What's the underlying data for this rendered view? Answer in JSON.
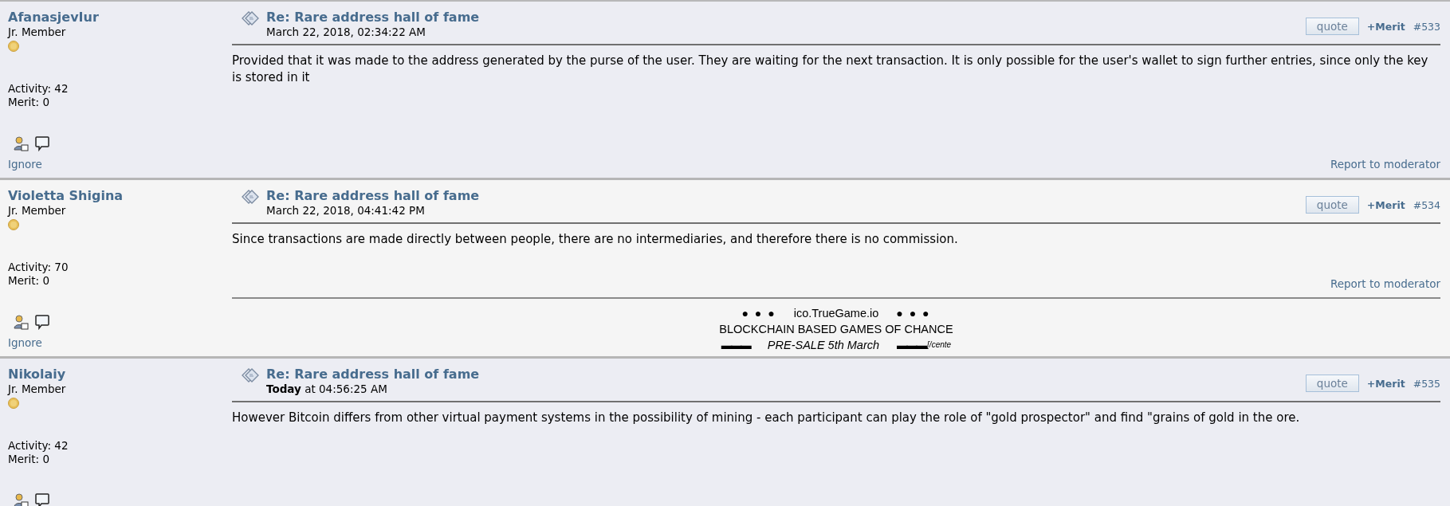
{
  "posts": [
    {
      "kind": "regular",
      "author": "AfanasjevIur",
      "rank": "Jr. Member",
      "activity": "Activity: 42",
      "merit": "Merit: 0",
      "ignore": "Ignore",
      "title": "Re: Rare address hall of fame",
      "date": "March 22, 2018, 02:34:22 AM",
      "quote": "quote",
      "merit_button": "+Merit",
      "number": "#533",
      "body": "Provided that it was made to the address generated by the purse of the user. They are waiting for the next transaction. It is only possible for the user's wallet to sign further entries, since only the key is stored in it",
      "report": "Report to moderator"
    },
    {
      "kind": "alternate",
      "author": "Violetta Shigina",
      "rank": "Jr. Member",
      "activity": "Activity: 70",
      "merit": "Merit: 0",
      "ignore": "Ignore",
      "title": "Re: Rare address hall of fame",
      "date": "March 22, 2018, 04:41:42 PM",
      "quote": "quote",
      "merit_button": "+Merit",
      "number": "#534",
      "body": "Since transactions are made directly between people, there are no intermediaries, and therefore there is no commission.",
      "report": "Report to moderator",
      "signature": {
        "dots_left": "● ● ●",
        "site": "ico.TrueGame.io",
        "dots_right": "● ● ●",
        "tagline": "BLOCKCHAIN BASED GAMES OF CHANCE",
        "bars_left": "▬▬▬",
        "presale": "PRE-SALE 5th March",
        "bars_right": "▬▬▬",
        "tail": "[/cente"
      }
    },
    {
      "kind": "regular",
      "author": "Nikolaiy",
      "rank": "Jr. Member",
      "activity": "Activity: 42",
      "merit": "Merit: 0",
      "title": "Re: Rare address hall of fame",
      "date": "**Today** at 04:56:25 AM",
      "quote": "quote",
      "merit_button": "+Merit",
      "number": "#535",
      "body": "However Bitcoin differs from other virtual payment systems in the possibility of mining - each participant can play the role of \"gold prospector\" and find \"grains of gold in the ore."
    }
  ]
}
